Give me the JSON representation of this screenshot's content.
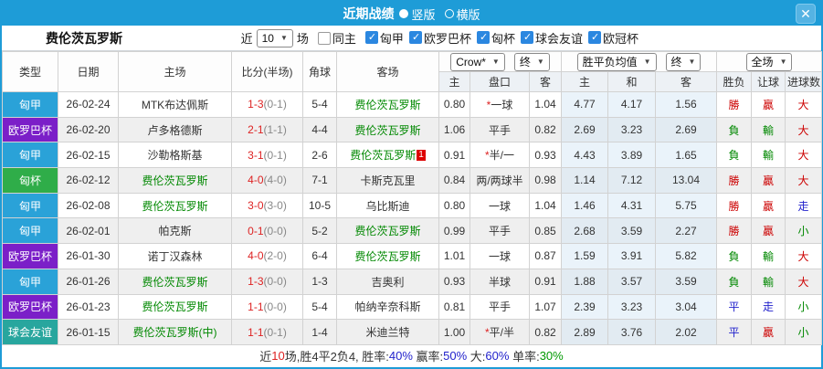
{
  "colors": {
    "topbar_blue": "#1e9cd7",
    "close_button_blue": "#55b3e3",
    "league_hungary": "#2aa2d8",
    "league_europa": "#7b1fc8",
    "league_cup": "#2fad49",
    "league_friendly": "#28a69e",
    "checkbox_blue": "#2b87e0",
    "team_green": "#008800",
    "score_red": "#dd2222",
    "half_gray": "#888888",
    "win_red": "#cc0000",
    "lose_green": "#008800",
    "draw_blue": "#2222cc",
    "pct_blue": "#2222cc",
    "pct_green": "#009900",
    "text_black": "#333333"
  },
  "titlebar": {
    "title": "近期战绩",
    "vertical_label": "竖版",
    "horizontal_label": "横版",
    "selected_mode": "竖版",
    "close_label": "✕"
  },
  "filterbar": {
    "team_name": "费伦茨瓦罗斯",
    "near_label": "近",
    "recent_count": "10",
    "games_label": "场",
    "same_home_label": "同主",
    "same_home_checked": false,
    "leagues": [
      {
        "label": "匈甲",
        "checked": true
      },
      {
        "label": "欧罗巴杯",
        "checked": true
      },
      {
        "label": "匈杯",
        "checked": true
      },
      {
        "label": "球会友谊",
        "checked": true
      },
      {
        "label": "欧冠杯",
        "checked": true
      }
    ]
  },
  "table": {
    "headers": {
      "type": "类型",
      "date": "日期",
      "home": "主场",
      "score": "比分(半场)",
      "corner": "角球",
      "away": "客场",
      "asia_home": "主",
      "asia_handicap": "盘口",
      "asia_away": "客",
      "euro_home": "主",
      "euro_draw": "和",
      "euro_away": "客",
      "result_wl": "胜负",
      "result_let": "让球",
      "result_goal": "进球数"
    },
    "selects": {
      "company": "Crow*",
      "company_time": "终",
      "euro_avg": "胜平负均值",
      "euro_time": "终",
      "scope": "全场"
    },
    "rows": [
      {
        "league": "匈甲",
        "league_color": "hungary",
        "date": "26-02-24",
        "home": "MTK布达佩斯",
        "home_hl": false,
        "score": "1-3",
        "half": "(0-1)",
        "corner": "5-4",
        "away": "费伦茨瓦罗斯",
        "away_hl": true,
        "away_badge": "",
        "star": true,
        "asia_home": "0.80",
        "handicap": "一球",
        "asia_away": "1.04",
        "euro_home": "4.77",
        "euro_draw": "4.17",
        "euro_away": "1.56",
        "result_wl": "勝",
        "result_wl_c": "red",
        "result_let": "贏",
        "result_let_c": "red",
        "result_goal": "大",
        "result_goal_c": "red"
      },
      {
        "league": "欧罗巴杯",
        "league_color": "europa",
        "date": "26-02-20",
        "home": "卢多格德斯",
        "home_hl": false,
        "score": "2-1",
        "half": "(1-1)",
        "corner": "4-4",
        "away": "费伦茨瓦罗斯",
        "away_hl": true,
        "away_badge": "",
        "star": false,
        "asia_home": "1.06",
        "handicap": "平手",
        "asia_away": "0.82",
        "euro_home": "2.69",
        "euro_draw": "3.23",
        "euro_away": "2.69",
        "result_wl": "負",
        "result_wl_c": "green",
        "result_let": "輸",
        "result_let_c": "green",
        "result_goal": "大",
        "result_goal_c": "red"
      },
      {
        "league": "匈甲",
        "league_color": "hungary",
        "date": "26-02-15",
        "home": "沙勒格斯基",
        "home_hl": false,
        "score": "3-1",
        "half": "(0-1)",
        "corner": "2-6",
        "away": "费伦茨瓦罗斯",
        "away_hl": true,
        "away_badge": "1",
        "star": true,
        "asia_home": "0.91",
        "handicap": "半/一",
        "asia_away": "0.93",
        "euro_home": "4.43",
        "euro_draw": "3.89",
        "euro_away": "1.65",
        "result_wl": "負",
        "result_wl_c": "green",
        "result_let": "輸",
        "result_let_c": "green",
        "result_goal": "大",
        "result_goal_c": "red"
      },
      {
        "league": "匈杯",
        "league_color": "cup",
        "date": "26-02-12",
        "home": "费伦茨瓦罗斯",
        "home_hl": true,
        "score": "4-0",
        "half": "(4-0)",
        "corner": "7-1",
        "away": "卡斯克瓦里",
        "away_hl": false,
        "away_badge": "",
        "star": false,
        "asia_home": "0.84",
        "handicap": "两/两球半",
        "asia_away": "0.98",
        "euro_home": "1.14",
        "euro_draw": "7.12",
        "euro_away": "13.04",
        "result_wl": "勝",
        "result_wl_c": "red",
        "result_let": "贏",
        "result_let_c": "red",
        "result_goal": "大",
        "result_goal_c": "red"
      },
      {
        "league": "匈甲",
        "league_color": "hungary",
        "date": "26-02-08",
        "home": "费伦茨瓦罗斯",
        "home_hl": true,
        "score": "3-0",
        "half": "(3-0)",
        "corner": "10-5",
        "away": "乌比斯迪",
        "away_hl": false,
        "away_badge": "",
        "star": false,
        "asia_home": "0.80",
        "handicap": "一球",
        "asia_away": "1.04",
        "euro_home": "1.46",
        "euro_draw": "4.31",
        "euro_away": "5.75",
        "result_wl": "勝",
        "result_wl_c": "red",
        "result_let": "贏",
        "result_let_c": "red",
        "result_goal": "走",
        "result_goal_c": "blue"
      },
      {
        "league": "匈甲",
        "league_color": "hungary",
        "date": "26-02-01",
        "home": "帕克斯",
        "home_hl": false,
        "score": "0-1",
        "half": "(0-0)",
        "corner": "5-2",
        "away": "费伦茨瓦罗斯",
        "away_hl": true,
        "away_badge": "",
        "star": false,
        "asia_home": "0.99",
        "handicap": "平手",
        "asia_away": "0.85",
        "euro_home": "2.68",
        "euro_draw": "3.59",
        "euro_away": "2.27",
        "result_wl": "勝",
        "result_wl_c": "red",
        "result_let": "贏",
        "result_let_c": "red",
        "result_goal": "小",
        "result_goal_c": "green"
      },
      {
        "league": "欧罗巴杯",
        "league_color": "europa",
        "date": "26-01-30",
        "home": "诺丁汉森林",
        "home_hl": false,
        "score": "4-0",
        "half": "(2-0)",
        "corner": "6-4",
        "away": "费伦茨瓦罗斯",
        "away_hl": true,
        "away_badge": "",
        "star": false,
        "asia_home": "1.01",
        "handicap": "一球",
        "asia_away": "0.87",
        "euro_home": "1.59",
        "euro_draw": "3.91",
        "euro_away": "5.82",
        "result_wl": "負",
        "result_wl_c": "green",
        "result_let": "輸",
        "result_let_c": "green",
        "result_goal": "大",
        "result_goal_c": "red"
      },
      {
        "league": "匈甲",
        "league_color": "hungary",
        "date": "26-01-26",
        "home": "费伦茨瓦罗斯",
        "home_hl": true,
        "score": "1-3",
        "half": "(0-0)",
        "corner": "1-3",
        "away": "吉奥利",
        "away_hl": false,
        "away_badge": "",
        "star": false,
        "asia_home": "0.93",
        "handicap": "半球",
        "asia_away": "0.91",
        "euro_home": "1.88",
        "euro_draw": "3.57",
        "euro_away": "3.59",
        "result_wl": "負",
        "result_wl_c": "green",
        "result_let": "輸",
        "result_let_c": "green",
        "result_goal": "大",
        "result_goal_c": "red"
      },
      {
        "league": "欧罗巴杯",
        "league_color": "europa",
        "date": "26-01-23",
        "home": "费伦茨瓦罗斯",
        "home_hl": true,
        "score": "1-1",
        "half": "(0-0)",
        "corner": "5-4",
        "away": "帕纳辛奈科斯",
        "away_hl": false,
        "away_badge": "",
        "star": false,
        "asia_home": "0.81",
        "handicap": "平手",
        "asia_away": "1.07",
        "euro_home": "2.39",
        "euro_draw": "3.23",
        "euro_away": "3.04",
        "result_wl": "平",
        "result_wl_c": "blue",
        "result_let": "走",
        "result_let_c": "blue",
        "result_goal": "小",
        "result_goal_c": "green"
      },
      {
        "league": "球会友谊",
        "league_color": "friendly",
        "date": "26-01-15",
        "home": "费伦茨瓦罗斯(中)",
        "home_hl": true,
        "score": "1-1",
        "half": "(0-1)",
        "corner": "1-4",
        "away": "米迪兰特",
        "away_hl": false,
        "away_badge": "",
        "star": true,
        "asia_home": "1.00",
        "handicap": "平/半",
        "asia_away": "0.82",
        "euro_home": "2.89",
        "euro_draw": "3.76",
        "euro_away": "2.02",
        "result_wl": "平",
        "result_wl_c": "blue",
        "result_let": "贏",
        "result_let_c": "red",
        "result_goal": "小",
        "result_goal_c": "green"
      }
    ]
  },
  "summary": {
    "segments": [
      {
        "text": "近",
        "color": "black"
      },
      {
        "text": "10",
        "color": "red"
      },
      {
        "text": "场,胜4平2负4, 胜率:",
        "color": "black"
      },
      {
        "text": "40%",
        "color": "blue"
      },
      {
        "text": " 赢率:",
        "color": "black"
      },
      {
        "text": "50%",
        "color": "blue"
      },
      {
        "text": " 大:",
        "color": "black"
      },
      {
        "text": "60%",
        "color": "blue"
      },
      {
        "text": " 单率:",
        "color": "black"
      },
      {
        "text": "30%",
        "color": "green"
      }
    ]
  }
}
